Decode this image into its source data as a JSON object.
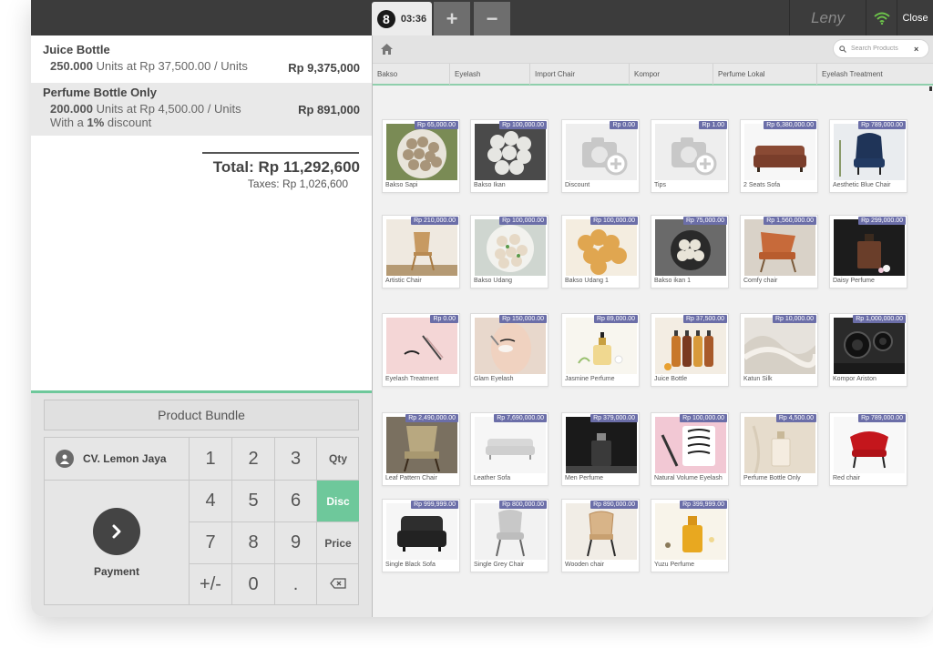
{
  "topbar": {
    "order_number": "8",
    "order_time": "03:36",
    "add_label": "+",
    "remove_label": "−",
    "user": "Leny",
    "close_label": "Close"
  },
  "order": {
    "lines": [
      {
        "name": "Juice Bottle",
        "qty": "250.000",
        "unit_text": "Units at Rp 37,500.00 / Units",
        "price": "Rp 9,375,000",
        "discount_prefix": "",
        "discount_value": "",
        "discount_suffix": ""
      },
      {
        "name": "Perfume Bottle Only",
        "qty": "200.000",
        "unit_text": "Units at Rp 4,500.00 / Units",
        "price": "Rp 891,000",
        "discount_prefix": "With a ",
        "discount_value": "1%",
        "discount_suffix": " discount"
      }
    ],
    "total": "Total: Rp 11,292,600",
    "taxes": "Taxes: Rp 1,026,600"
  },
  "actions": {
    "product_bundle": "Product Bundle",
    "customer": "CV. Lemon Jaya",
    "payment": "Payment"
  },
  "numpad": {
    "keys": [
      "1",
      "2",
      "3",
      "4",
      "5",
      "6",
      "7",
      "8",
      "9",
      "+/-",
      "0",
      "."
    ],
    "qty": "Qty",
    "disc": "Disc",
    "price": "Price",
    "active_mode": "Disc"
  },
  "search": {
    "placeholder": "Search Products",
    "clear": "×"
  },
  "categories": [
    "Bakso",
    "Eyelash",
    "Import Chair",
    "Kompor",
    "Perfume Lokal",
    "Eyelash Treatment"
  ],
  "products": [
    {
      "name": "Bakso Sapi",
      "price": "Rp 65,000.00",
      "img": "bakso"
    },
    {
      "name": "Bakso Ikan",
      "price": "Rp 100,000.00",
      "img": "bakso-white"
    },
    {
      "name": "Discount",
      "price": "Rp 0.00",
      "img": "camera"
    },
    {
      "name": "Tips",
      "price": "Rp 1.00",
      "img": "camera"
    },
    {
      "name": "2 Seats Sofa",
      "price": "Rp 6,380,000.00",
      "img": "sofa-brown"
    },
    {
      "name": "Aesthetic Blue Chair",
      "price": "Rp 789,000.00",
      "img": "chair-blue"
    },
    {
      "name": "Artistic Chair",
      "price": "Rp 210,000.00",
      "img": "chair-wood"
    },
    {
      "name": "Bakso Udang",
      "price": "Rp 100,000.00",
      "img": "bakso-bowl"
    },
    {
      "name": "Bakso Udang 1",
      "price": "Rp 100,000.00",
      "img": "fried"
    },
    {
      "name": "Bakso ikan 1",
      "price": "Rp 75,000.00",
      "img": "bakso-dark"
    },
    {
      "name": "Comfy chair",
      "price": "Rp 1,560,000.00",
      "img": "chair-orange"
    },
    {
      "name": "Daisy Perfume",
      "price": "Rp 299,000.00",
      "img": "perfume-dark"
    },
    {
      "name": "Eyelash Treatment",
      "price": "Rp 0.00",
      "img": "eyelash-pink"
    },
    {
      "name": "Glam Eyelash",
      "price": "Rp 150,000.00",
      "img": "face"
    },
    {
      "name": "Jasmine Perfume",
      "price": "Rp 89,000.00",
      "img": "perfume-light"
    },
    {
      "name": "Juice Bottle",
      "price": "Rp 37,500.00",
      "img": "bottles"
    },
    {
      "name": "Katun Silk",
      "price": "Rp 10,000.00",
      "img": "silk"
    },
    {
      "name": "Kompor Ariston",
      "price": "Rp 1,000,000.00",
      "img": "stove"
    },
    {
      "name": "Leaf Pattern Chair",
      "price": "Rp 2,490,000.00",
      "img": "chair-leaf"
    },
    {
      "name": "Leather Sofa",
      "price": "Rp 7,690,000.00",
      "img": "sofa-white"
    },
    {
      "name": "Men Perfume",
      "price": "Rp 379,000.00",
      "img": "perfume-black"
    },
    {
      "name": "Natural Volume Eyelash",
      "price": "Rp 100,000.00",
      "img": "eyelash-box"
    },
    {
      "name": "Perfume Bottle Only",
      "price": "Rp 4,500.00",
      "img": "bottle-beige"
    },
    {
      "name": "Red chair",
      "price": "Rp 789,000.00",
      "img": "chair-red"
    },
    {
      "name": "Single Black Sofa",
      "price": "Rp 999,999.00",
      "img": "sofa-black"
    },
    {
      "name": "Single Grey Chair",
      "price": "Rp 800,000.00",
      "img": "chair-grey"
    },
    {
      "name": "Wooden chair",
      "price": "Rp 890,000.00",
      "img": "chair-rattan"
    },
    {
      "name": "Yuzu Perfume",
      "price": "Rp 399,999.00",
      "img": "perfume-gold"
    }
  ],
  "colors": {
    "topbar": "#3c3c3c",
    "accent_green": "#6ec89b",
    "price_badge": "#6b6ea8",
    "wifi": "#6cc24a"
  }
}
